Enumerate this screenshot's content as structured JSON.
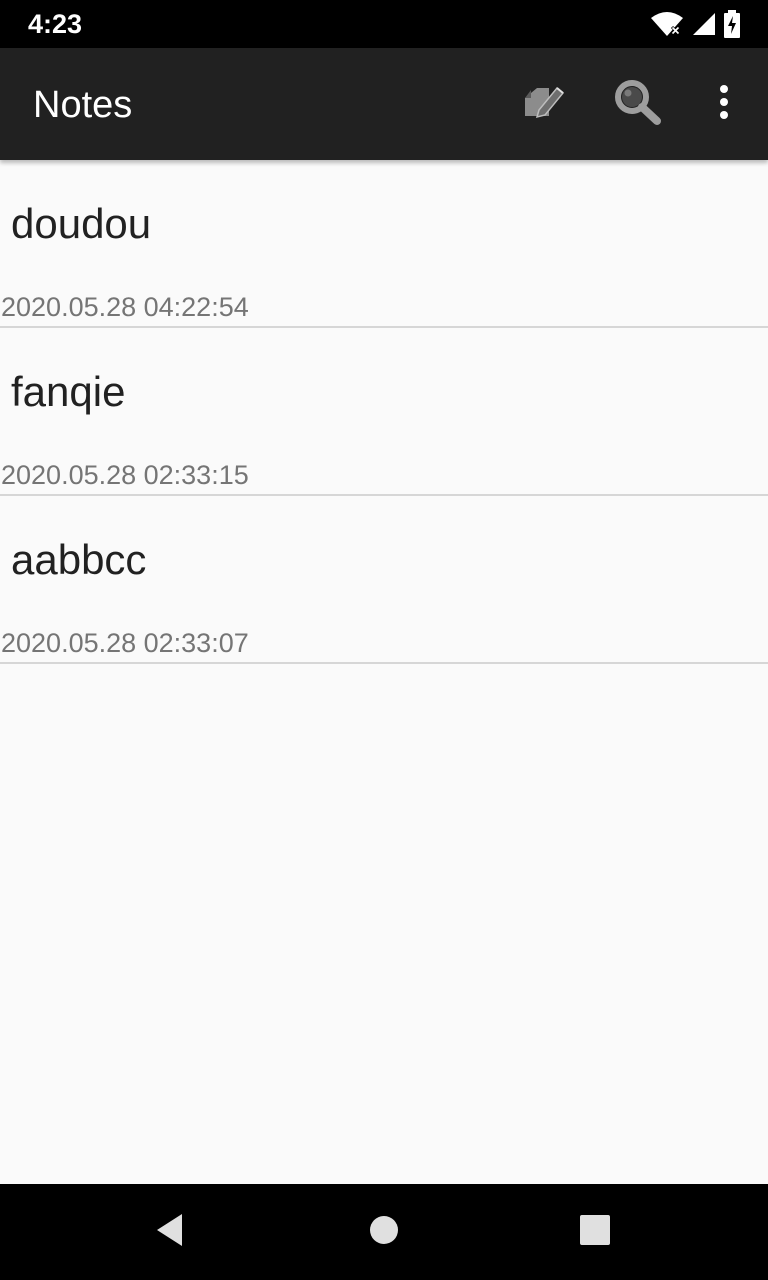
{
  "status_bar": {
    "time": "4:23",
    "icons": [
      "wifi-icon",
      "signal-icon",
      "battery-charging-icon"
    ]
  },
  "app_bar": {
    "title": "Notes",
    "actions": [
      {
        "name": "new-note",
        "icon": "compose-icon"
      },
      {
        "name": "search",
        "icon": "search-icon"
      },
      {
        "name": "overflow",
        "icon": "more-vert-icon"
      }
    ]
  },
  "notes": [
    {
      "title": "doudou",
      "time": "2020.05.28 04:22:54"
    },
    {
      "title": "fanqie",
      "time": "2020.05.28 02:33:15"
    },
    {
      "title": "aabbcc",
      "time": "2020.05.28 02:33:07"
    }
  ],
  "nav_bar": {
    "buttons": [
      "back-icon",
      "home-icon",
      "recents-icon"
    ]
  },
  "colors": {
    "app_bar": "#212121",
    "background": "#fafafa",
    "title_text": "#212121",
    "time_text": "#757575",
    "divider": "#d6d6d6"
  }
}
